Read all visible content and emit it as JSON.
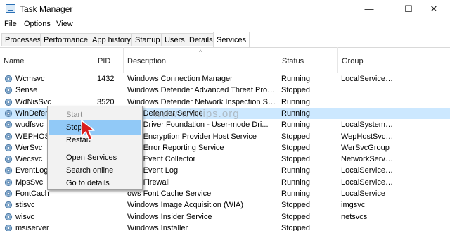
{
  "window": {
    "title": "Task Manager",
    "minimize_glyph": "—",
    "maximize_glyph": "☐",
    "close_glyph": "✕"
  },
  "menu": [
    "File",
    "Options",
    "View"
  ],
  "tabs": [
    "Processes",
    "Performance",
    "App history",
    "Startup",
    "Users",
    "Details",
    "Services"
  ],
  "active_tab": "Services",
  "columns": [
    "Name",
    "PID",
    "Description",
    "Status",
    "Group"
  ],
  "rows": [
    {
      "name": "Wcmsvc",
      "pid": "1432",
      "description": "Windows Connection Manager",
      "status": "Running",
      "group": "LocalServiceN..."
    },
    {
      "name": "Sense",
      "pid": "",
      "description": "Windows Defender Advanced Threat Protect...",
      "status": "Stopped",
      "group": ""
    },
    {
      "name": "WdNisSvc",
      "pid": "3520",
      "description": "Windows Defender Network Inspection Servi...",
      "status": "Running",
      "group": ""
    },
    {
      "name": "WinDefen",
      "pid": "",
      "description": "ows Defender Service",
      "status": "Running",
      "group": ""
    },
    {
      "name": "wudfsvc",
      "pid": "",
      "description": "ows Driver Foundation - User-mode Dri...",
      "status": "Running",
      "group": "LocalSystemN..."
    },
    {
      "name": "WEPHOST",
      "pid": "",
      "description": "ows Encryption Provider Host Service",
      "status": "Stopped",
      "group": "WepHostSvcG..."
    },
    {
      "name": "WerSvc",
      "pid": "",
      "description": "ows Error Reporting Service",
      "status": "Stopped",
      "group": "WerSvcGroup"
    },
    {
      "name": "Wecsvc",
      "pid": "",
      "description": "ows Event Collector",
      "status": "Stopped",
      "group": "NetworkService"
    },
    {
      "name": "EventLog",
      "pid": "",
      "description": "ows Event Log",
      "status": "Running",
      "group": "LocalServiceN..."
    },
    {
      "name": "MpsSvc",
      "pid": "",
      "description": "ows Firewall",
      "status": "Running",
      "group": "LocalServiceN..."
    },
    {
      "name": "FontCach",
      "pid": "",
      "description": "ows Font Cache Service",
      "status": "Running",
      "group": "LocalService"
    },
    {
      "name": "stisvc",
      "pid": "",
      "description": "Windows Image Acquisition (WIA)",
      "status": "Stopped",
      "group": "imgsvc"
    },
    {
      "name": "wisvc",
      "pid": "",
      "description": "Windows Insider Service",
      "status": "Stopped",
      "group": "netsvcs"
    },
    {
      "name": "msiserver",
      "pid": "",
      "description": "Windows Installer",
      "status": "Stopped",
      "group": ""
    }
  ],
  "selected_row_index": 3,
  "context_menu": {
    "items": [
      {
        "label": "Start",
        "enabled": false
      },
      {
        "label": "Stop",
        "enabled": true,
        "highlighted": true
      },
      {
        "label": "Restart",
        "enabled": true
      },
      {
        "label": "Open Services",
        "enabled": true
      },
      {
        "label": "Search online",
        "enabled": true
      },
      {
        "label": "Go to details",
        "enabled": true
      }
    ]
  },
  "watermark": "www.wintips.org",
  "colors": {
    "selection": "#cce8ff",
    "menu_highlight": "#91c9f7",
    "pointer_arrow": "#d81e1e"
  }
}
